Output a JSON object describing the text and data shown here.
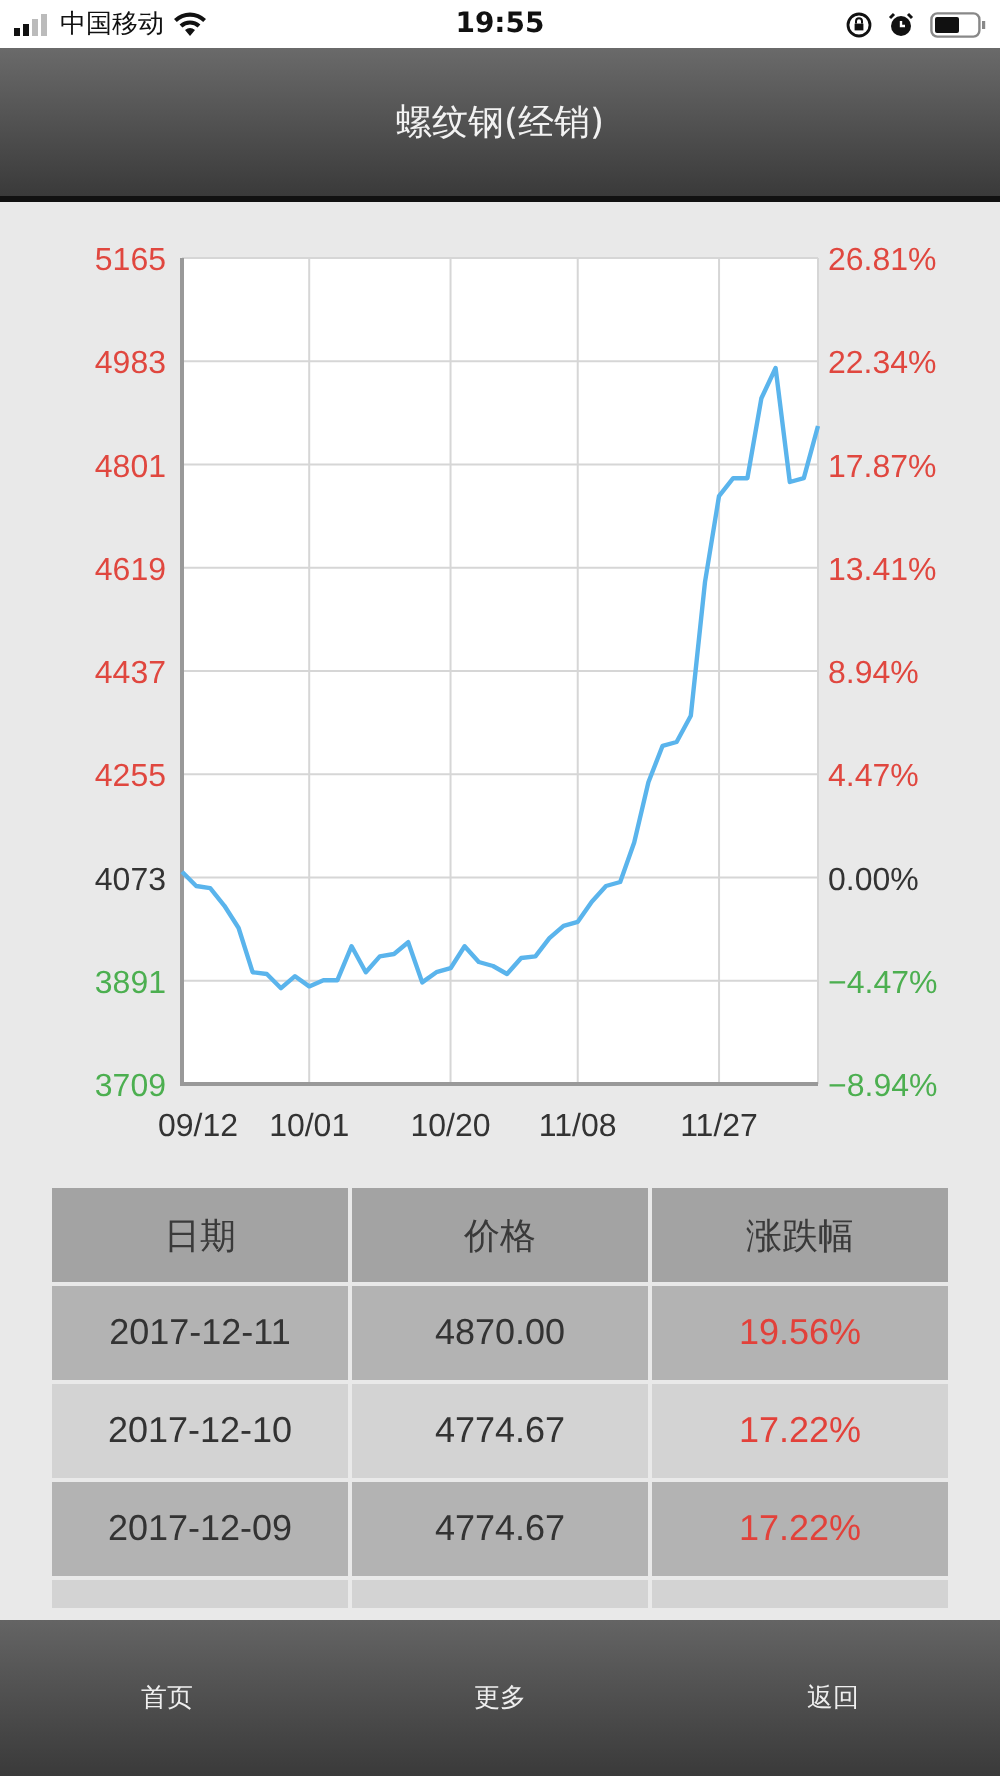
{
  "status_bar": {
    "carrier": "中国移动",
    "time": "19:55"
  },
  "header": {
    "title": "螺纹钢(经销)"
  },
  "chart_data": {
    "type": "line",
    "ylim": [
      3709,
      5165
    ],
    "grid": true,
    "categories": [
      "09/12",
      null,
      null,
      null,
      null,
      null,
      null,
      null,
      null,
      "10/01",
      null,
      null,
      null,
      null,
      null,
      null,
      null,
      null,
      null,
      "10/20",
      null,
      null,
      null,
      null,
      null,
      null,
      null,
      null,
      "11/08",
      null,
      null,
      null,
      null,
      null,
      null,
      null,
      null,
      null,
      "11/27",
      null,
      null,
      null,
      null,
      null,
      null,
      null
    ],
    "yticks": [
      {
        "value": 5165,
        "label": "5165"
      },
      {
        "value": 4983,
        "label": "4983"
      },
      {
        "value": 4801,
        "label": "4801"
      },
      {
        "value": 4619,
        "label": "4619"
      },
      {
        "value": 4437,
        "label": "4437"
      },
      {
        "value": 4255,
        "label": "4255"
      },
      {
        "value": 4073,
        "label": "4073"
      },
      {
        "value": 3891,
        "label": "3891"
      },
      {
        "value": 3709,
        "label": "3709"
      }
    ],
    "series": [
      {
        "color": "#5ab4ec",
        "values": [
          4083,
          4058,
          4054,
          4023,
          3984,
          3906,
          3903,
          3878,
          3899,
          3881,
          3892,
          3892,
          3952,
          3906,
          3934,
          3938,
          3959,
          3888,
          3906,
          3913,
          3952,
          3924,
          3917,
          3903,
          3931,
          3934,
          3966,
          3988,
          3995,
          4030,
          4058,
          4065,
          4135,
          4241,
          4305,
          4312,
          4358,
          4594,
          4745,
          4777,
          4777,
          4918,
          4971,
          4770,
          4777,
          4869
        ]
      }
    ]
  },
  "right_axis": [
    {
      "label": "26.81%",
      "color": "#e0473f"
    },
    {
      "label": "22.34%",
      "color": "#e0473f"
    },
    {
      "label": "17.87%",
      "color": "#e0473f"
    },
    {
      "label": "13.41%",
      "color": "#e0473f"
    },
    {
      "label": "8.94%",
      "color": "#e0473f"
    },
    {
      "label": "4.47%",
      "color": "#e0473f"
    },
    {
      "label": "0.00%",
      "color": "#333333"
    },
    {
      "label": "−4.47%",
      "color": "#4caf50"
    },
    {
      "label": "−8.94%",
      "color": "#4caf50"
    }
  ],
  "table": {
    "columns": [
      "日期",
      "价格",
      "涨跌幅"
    ],
    "rows": [
      {
        "date": "2017-12-11",
        "price": "4870.00",
        "change": "19.56%",
        "color": "#e2413a"
      },
      {
        "date": "2017-12-10",
        "price": "4774.67",
        "change": "17.22%",
        "color": "#e2413a"
      },
      {
        "date": "2017-12-09",
        "price": "4774.67",
        "change": "17.22%",
        "color": "#e2413a"
      }
    ]
  },
  "bottom_nav": [
    {
      "label": "首页"
    },
    {
      "label": "更多"
    },
    {
      "label": "返回"
    }
  ]
}
